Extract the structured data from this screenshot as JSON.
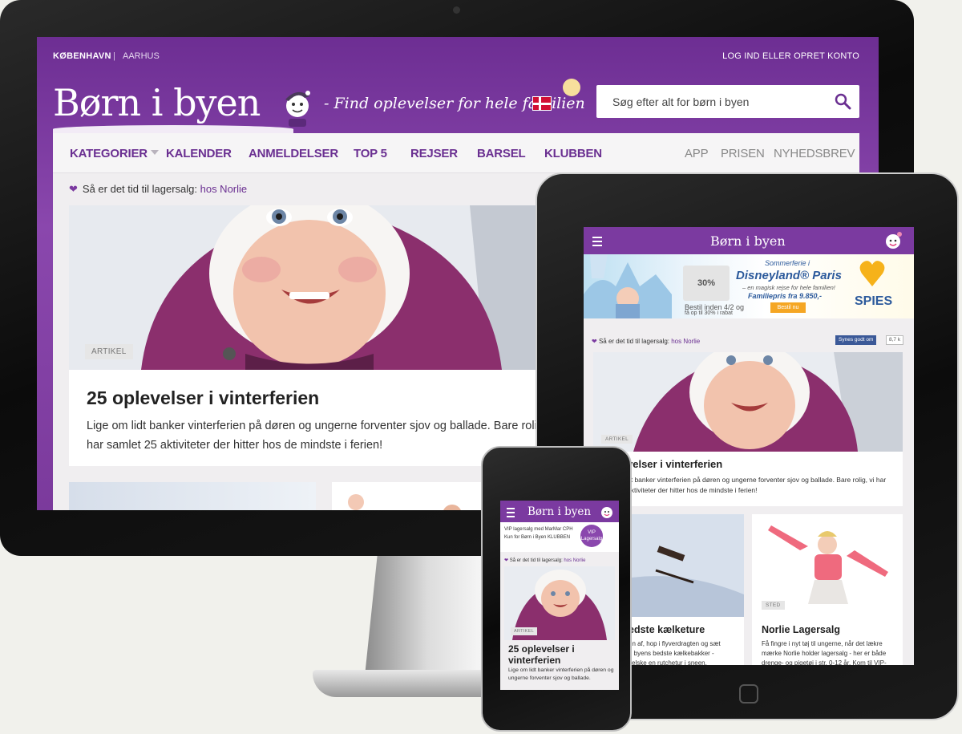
{
  "desktop": {
    "cities": {
      "active": "KØBENHAVN",
      "separator": "|",
      "other": "AARHUS"
    },
    "login": "LOG IND ELLER OPRET KONTO",
    "logo": "Børn i byen",
    "tagline": "- Find oplevelser for hele familien",
    "search_placeholder": "Søg efter alt for børn i byen",
    "nav": {
      "kategorier": "KATEGORIER",
      "kalender": "KALENDER",
      "anmeldelser": "ANMELDELSER",
      "top5": "TOP 5",
      "rejser": "REJSER",
      "barsel": "BARSEL",
      "klubben": "KLUBBEN",
      "app": "APP",
      "prisen": "PRISEN",
      "nyhedsbrev": "NYHEDSBREV"
    },
    "promo": {
      "text": "Så er det tid til lagersalg:",
      "link": "hos Norlie"
    },
    "featured": {
      "tag": "ARTIKEL",
      "title": "25 oplevelser i vinterferien",
      "line1": "Lige om lidt banker vinterferien på døren og ungerne forventer sjov og ballade. Bare roli",
      "line2": "har samlet 25 aktiviteter der hitter hos de mindste i ferien!"
    }
  },
  "tablet": {
    "logo": "Børn i byen",
    "ad": {
      "sommer": "Sommerferie i",
      "title": "Disneyland® Paris",
      "sub": "– en magisk rejse for hele familien!",
      "price": "Familiepris fra 9.850,-",
      "button": "Bestil nu",
      "discount": "30%",
      "book": "Bestil inden 4/2 og",
      "save": "få op til 30% i rabat",
      "brand": "SPIES"
    },
    "promo": {
      "text": "Så er det tid til lagersalg:",
      "link": "hos Norlie"
    },
    "fb_like": "Synes godt om",
    "fb_count": "8,7 k",
    "featured": {
      "tag": "ARTIKEL",
      "title": "velser i vinterferien",
      "line1": "dt banker vinterferien på døren og ungerne forventer sjov og ballade. Bare rolig, vi har",
      "line2": "aktiviteter der hitter hos de mindste i ferien!"
    },
    "card_left": {
      "title": "edste kælketure",
      "line1": "en af, hop i flyverdragten og sæt",
      "line2": "d byens bedste kælkebakker -",
      "line3": "l elske en rutchetur i sneen."
    },
    "card_right": {
      "tag": "STED",
      "title": "Norlie Lagersalg",
      "line1": "Få fingre i nyt tøj til ungerne, når det lækre",
      "line2": "mærke Norlie holder lagersalg - her er både",
      "line3": "drenge- og pigetøj i str. 0-12 år. Kom til VIP-"
    }
  },
  "phone": {
    "logo": "Børn i byen",
    "ad": {
      "line1": "VIP lagersalg med MarMar CPH",
      "line2": "Kun for Børn i Byen KLUBBEN",
      "badge1": "VIP",
      "badge2": "Lagersalg"
    },
    "promo": {
      "text": "Så er det tid til lagersalg:",
      "link": "hos Norlie"
    },
    "featured": {
      "tag": "ARTIKEL",
      "title": "25 oplevelser i vinterferien",
      "desc": "Lige om lidt banker vinterferien på døren og ungerne forventer sjov og ballade."
    }
  },
  "colors": {
    "brand_purple": "#7b3aa0",
    "page_bg": "#f0eef0",
    "flag_red": "#d21034"
  }
}
